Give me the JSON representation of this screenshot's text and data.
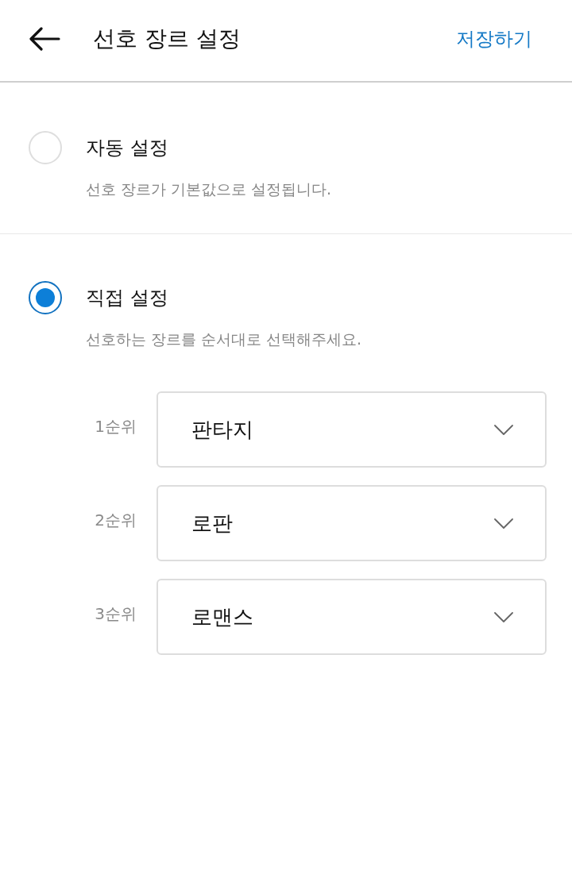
{
  "header": {
    "title": "선호 장르 설정",
    "save_label": "저장하기"
  },
  "options": [
    {
      "label": "자동 설정",
      "description": "선호 장르가 기본값으로 설정됩니다.",
      "selected": false
    },
    {
      "label": "직접 설정",
      "description": "선호하는 장르를 순서대로 선택해주세요.",
      "selected": true,
      "rankings": [
        {
          "rank": "1순위",
          "value": "판타지"
        },
        {
          "rank": "2순위",
          "value": "로판"
        },
        {
          "rank": "3순위",
          "value": "로맨스"
        }
      ]
    }
  ]
}
